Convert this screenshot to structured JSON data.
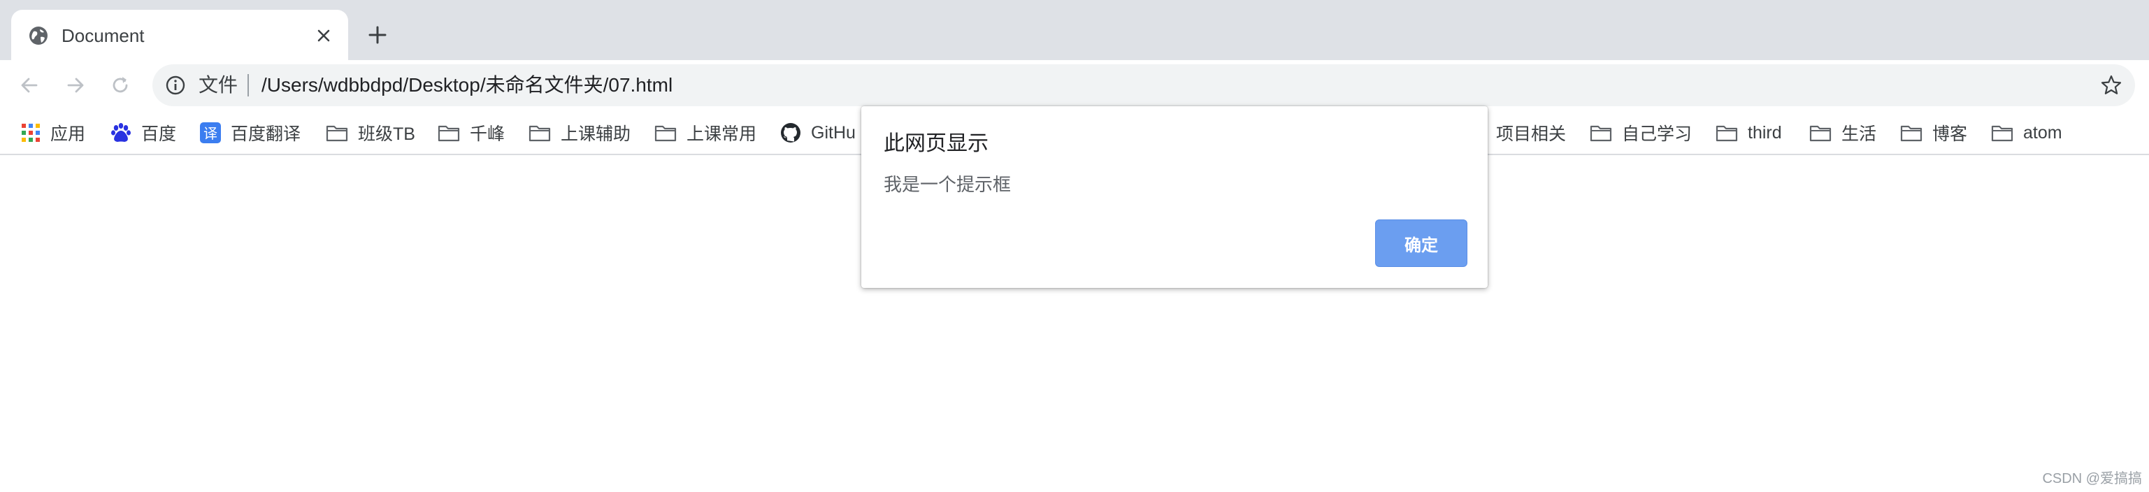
{
  "tab": {
    "title": "Document",
    "favicon": "globe-icon",
    "close_icon": "close-icon"
  },
  "newtab_icon": "plus-icon",
  "nav": {
    "back_icon": "arrow-left-icon",
    "forward_icon": "arrow-right-icon",
    "reload_icon": "reload-icon"
  },
  "omnibox": {
    "info_icon": "info-icon",
    "scheme_label": "文件",
    "url": "/Users/wdbbdpd/Desktop/未命名文件夹/07.html",
    "star_icon": "star-icon"
  },
  "bookmarks": [
    {
      "label": "应用",
      "icon": "apps-grid-icon"
    },
    {
      "label": "百度",
      "icon": "baidu-paw-icon"
    },
    {
      "label": "百度翻译",
      "icon": "translate-icon"
    },
    {
      "label": "班级TB",
      "icon": "folder-icon"
    },
    {
      "label": "千峰",
      "icon": "folder-icon"
    },
    {
      "label": "上课辅助",
      "icon": "folder-icon"
    },
    {
      "label": "上课常用",
      "icon": "folder-icon"
    },
    {
      "label": "GitHu",
      "icon": "github-icon"
    },
    {
      "label": "项目相关",
      "icon": "folder-icon"
    },
    {
      "label": "自己学习",
      "icon": "folder-icon"
    },
    {
      "label": "third",
      "icon": "folder-icon"
    },
    {
      "label": "生活",
      "icon": "folder-icon"
    },
    {
      "label": "博客",
      "icon": "folder-icon"
    },
    {
      "label": "atom",
      "icon": "folder-icon"
    }
  ],
  "dialog": {
    "title": "此网页显示",
    "message": "我是一个提示框",
    "ok_label": "确定"
  },
  "watermark": "CSDN @爱搞搞",
  "colors": {
    "tabstrip": "#dee1e6",
    "omnibox": "#f1f3f4",
    "ok_button": "#6b9ef0"
  }
}
